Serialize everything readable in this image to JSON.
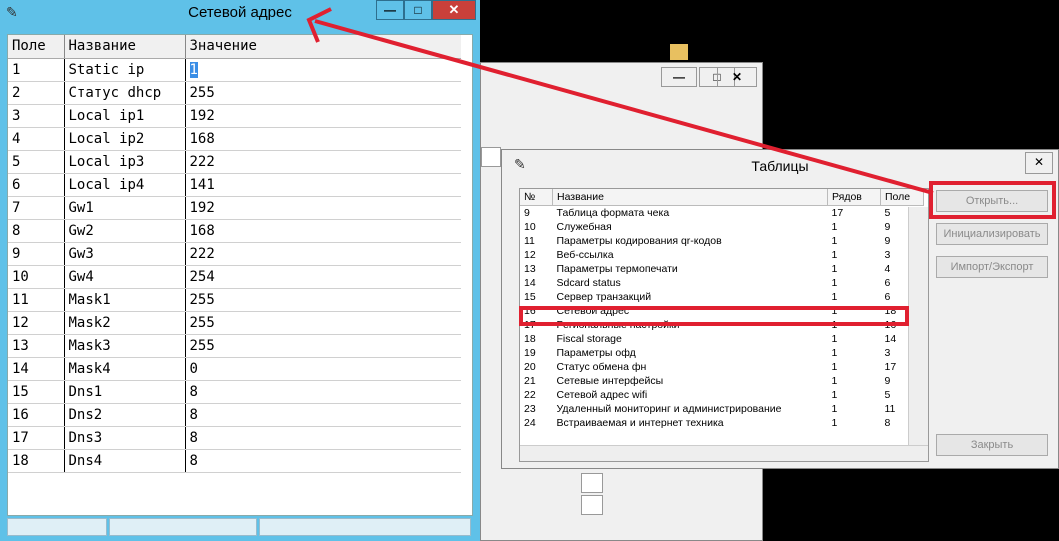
{
  "left_window": {
    "title": "Сетевой адрес",
    "controls": {
      "minimize": "—",
      "maximize": "□",
      "close": "✕"
    },
    "columns": [
      "Поле",
      "Название",
      "Значение"
    ],
    "rows": [
      {
        "field": "1",
        "name": "Static ip",
        "value": "1"
      },
      {
        "field": "2",
        "name": "Статус dhcp",
        "value": "255"
      },
      {
        "field": "3",
        "name": "Local ip1",
        "value": "192"
      },
      {
        "field": "4",
        "name": "Local ip2",
        "value": "168"
      },
      {
        "field": "5",
        "name": "Local ip3",
        "value": "222"
      },
      {
        "field": "6",
        "name": "Local ip4",
        "value": "141"
      },
      {
        "field": "7",
        "name": "Gw1",
        "value": "192"
      },
      {
        "field": "8",
        "name": "Gw2",
        "value": "168"
      },
      {
        "field": "9",
        "name": "Gw3",
        "value": "222"
      },
      {
        "field": "10",
        "name": "Gw4",
        "value": "254"
      },
      {
        "field": "11",
        "name": "Mask1",
        "value": "255"
      },
      {
        "field": "12",
        "name": "Mask2",
        "value": "255"
      },
      {
        "field": "13",
        "name": "Mask3",
        "value": "255"
      },
      {
        "field": "14",
        "name": "Mask4",
        "value": "0"
      },
      {
        "field": "15",
        "name": "Dns1",
        "value": "8"
      },
      {
        "field": "16",
        "name": "Dns2",
        "value": "8"
      },
      {
        "field": "17",
        "name": "Dns3",
        "value": "8"
      },
      {
        "field": "18",
        "name": "Dns4",
        "value": "8"
      }
    ]
  },
  "middle_window": {
    "controls": {
      "minimize": "—",
      "maximize": "□",
      "close": "✕"
    }
  },
  "tables_window": {
    "title": "Таблицы",
    "close": "✕",
    "columns": [
      "№",
      "Название",
      "Рядов",
      "Поле"
    ],
    "rows": [
      {
        "n": "9",
        "name": "Таблица формата чека",
        "rows": "17",
        "fields": "5"
      },
      {
        "n": "10",
        "name": "Служебная",
        "rows": "1",
        "fields": "9"
      },
      {
        "n": "11",
        "name": "Параметры кодирования qr-кодов",
        "rows": "1",
        "fields": "9"
      },
      {
        "n": "12",
        "name": "Веб-ссылка",
        "rows": "1",
        "fields": "3"
      },
      {
        "n": "13",
        "name": "Параметры термопечати",
        "rows": "1",
        "fields": "4"
      },
      {
        "n": "14",
        "name": "Sdcard status",
        "rows": "1",
        "fields": "6"
      },
      {
        "n": "15",
        "name": "Сервер транзакций",
        "rows": "1",
        "fields": "6"
      },
      {
        "n": "16",
        "name": "Сетевой адрес",
        "rows": "1",
        "fields": "18"
      },
      {
        "n": "17",
        "name": "Региональные настройки",
        "rows": "1",
        "fields": "16"
      },
      {
        "n": "18",
        "name": "Fiscal storage",
        "rows": "1",
        "fields": "14"
      },
      {
        "n": "19",
        "name": "Параметры офд",
        "rows": "1",
        "fields": "3"
      },
      {
        "n": "20",
        "name": "Статус обмена фн",
        "rows": "1",
        "fields": "17"
      },
      {
        "n": "21",
        "name": "Сетевые интерфейсы",
        "rows": "1",
        "fields": "9"
      },
      {
        "n": "22",
        "name": "Сетевой адрес wifi",
        "rows": "1",
        "fields": "5"
      },
      {
        "n": "23",
        "name": "Удаленный мониторинг и администрирование",
        "rows": "1",
        "fields": "11"
      },
      {
        "n": "24",
        "name": "Встраиваемая и интернет техника",
        "rows": "1",
        "fields": "8"
      }
    ],
    "buttons": {
      "open": "Открыть...",
      "init": "Инициализировать",
      "import_export": "Импорт/Экспорт",
      "close": "Закрыть"
    }
  },
  "colors": {
    "annotation_red": "#e02030",
    "window_blue": "#5fc1e8"
  }
}
